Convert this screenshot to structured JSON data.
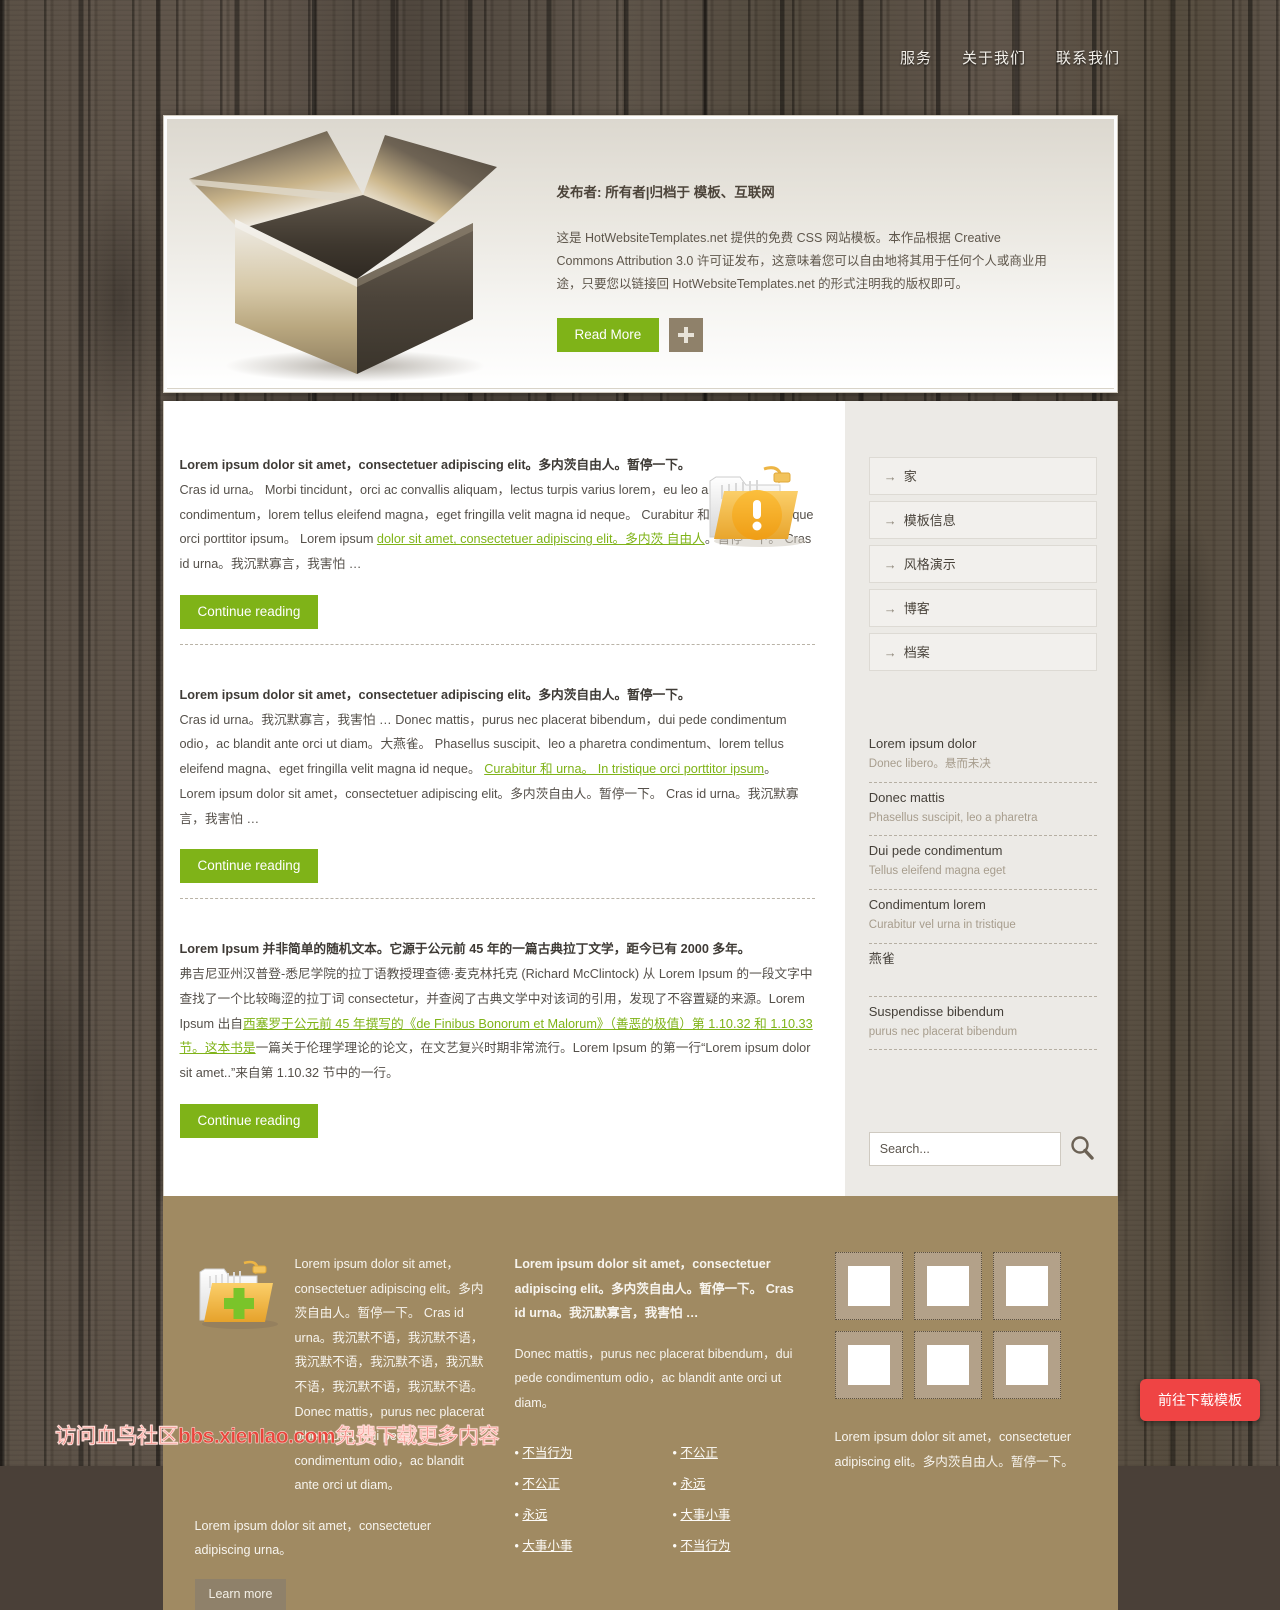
{
  "nav": {
    "items": [
      {
        "label": "服务"
      },
      {
        "label": "关于我们"
      },
      {
        "label": "联系我们"
      }
    ]
  },
  "banner": {
    "image_alt": "open-cardboard-box",
    "meta": "发布者: 所有者|归档于 模板、互联网",
    "description": "这是 HotWebsiteTemplates.net 提供的免费 CSS 网站模板。本作品根据 Creative Commons Attribution 3.0 许可证发布，这意味着您可以自由地将其用于任何个人或商业用途，只要您以链接回 HotWebsiteTemplates.net 的形式注明我的版权即可。",
    "read_more_label": "Read More",
    "plus_label": "+"
  },
  "posts": [
    {
      "lead": "Lorem ipsum dolor sit amet，consectetuer adipiscing elit。多内茨自由人。暂停一下。",
      "body_1": "Cras id urna。 Morbi tincidunt，orci ac convallis aliquam，lectus turpis varius lorem，eu leo a pharetra condimentum，lorem tellus eleifend magna，eget fringilla velit magna id neque。 Curabitur 和 urna。 In tristique orci porttitor ipsum。 Lorem ipsum ",
      "link": "dolor sit amet, consectetuer adipiscing elit。多内茨 自由人",
      "body_2": "。暂停一下。 Cras id urna。我沉默寡言，我害怕 …",
      "button": "Continue reading",
      "icon": "folder-warning-icon"
    },
    {
      "lead": "Lorem ipsum dolor sit amet，consectetuer adipiscing elit。多内茨自由人。暂停一下。",
      "body_1": "Cras id urna。我沉默寡言，我害怕 … Donec mattis，purus nec placerat bibendum，dui pede condimentum odio，ac blandit ante orci ut diam。大燕雀。 Phasellus suscipit、leo a pharetra condimentum、lorem tellus eleifend magna、eget fringilla velit magna id neque。 ",
      "link": "Curabitur 和 urna。 In tristique orci porttitor ipsum",
      "body_2": "。 Lorem ipsum dolor sit amet，consectetuer adipiscing elit。多内茨自由人。暂停一下。 Cras id urna。我沉默寡言，我害怕 …",
      "button": "Continue reading",
      "icon": ""
    },
    {
      "lead": "Lorem Ipsum 并非简单的随机文本。它源于公元前 45 年的一篇古典拉丁文学，距今已有 2000 多年。",
      "body_1": "弗吉尼亚州汉普登-悉尼学院的拉丁语教授理查德·麦克林托克 (Richard McClintock) 从 Lorem Ipsum 的一段文字中查找了一个比较晦涩的拉丁词 consectetur，并查阅了古典文学中对该词的引用，发现了不容置疑的来源。Lorem Ipsum 出自",
      "link": "西塞罗于公元前 45 年撰写的《de Finibus Bonorum et Malorum》（善恶的极值）第 1.10.32 和 1.10.33 节。这本书是",
      "body_2": "一篇关于伦理学理论的论文，在文艺复兴时期非常流行。Lorem Ipsum 的第一行“Lorem ipsum dolor sit amet..”来自第 1.10.32 节中的一行。",
      "button": "Continue reading",
      "icon": ""
    }
  ],
  "sidebar": {
    "nav": [
      {
        "label": "家"
      },
      {
        "label": "模板信息"
      },
      {
        "label": "风格演示"
      },
      {
        "label": "博客"
      },
      {
        "label": "档案"
      }
    ],
    "list": [
      {
        "title": "Lorem ipsum dolor",
        "sub": "Donec libero。悬而未决"
      },
      {
        "title": "Donec mattis",
        "sub": "Phasellus suscipit, leo a pharetra"
      },
      {
        "title": "Dui pede condimentum",
        "sub": "Tellus eleifend magna eget"
      },
      {
        "title": "Condimentum lorem",
        "sub": "Curabitur vel urna in tristique"
      },
      {
        "title": "燕雀",
        "sub": ""
      },
      {
        "title": "Suspendisse bibendum",
        "sub": "purus nec placerat bibendum"
      }
    ],
    "search": {
      "placeholder": "Search...",
      "value": "",
      "icon": "search-icon"
    }
  },
  "footer": {
    "col1": {
      "icon": "folder-add-icon",
      "text_1": "Lorem ipsum dolor sit amet，consectetuer adipiscing elit。多内茨自由人。暂停一下。 Cras id urna。我沉默不语，我沉默不语，我沉默不语，我沉默不语，我沉默不语，我沉默不语，我沉默不语。 Donec mattis，purus nec placerat bibendum，dui pede condimentum odio，ac blandit ante orci ut diam。",
      "text_2": "Lorem ipsum dolor sit amet，consectetuer adipiscing urna。",
      "button": "Learn more"
    },
    "col2": {
      "text_bold": "Lorem ipsum dolor sit amet，consectetuer adipiscing elit。多内茨自由人。暂停一下。 Cras id urna。我沉默寡言，我害怕 …",
      "text_plain": "Donec mattis，purus nec placerat bibendum，dui pede condimentum odio，ac blandit ante orci ut diam。",
      "list_a": [
        "不当行为",
        "不公正",
        "永远",
        "大事小事"
      ],
      "list_b": [
        "不公正",
        "永远",
        "大事小事",
        "不当行为"
      ]
    },
    "col3": {
      "gallery_count": 6,
      "text": "Lorem ipsum dolor sit amet，consectetuer adipiscing elit。多内茨自由人。暂停一下。"
    }
  },
  "watermark": {
    "text": "访问血鸟社区bbs.xienIao.com免费下载更多内容"
  },
  "download_button": {
    "label": "前往下载模板"
  },
  "colors": {
    "accent_green": "#7fb318",
    "footer_brown": "#a08a62",
    "wood_dark": "#4f463d",
    "download_red": "#ef4444",
    "watermark_red": "#e8463c"
  }
}
